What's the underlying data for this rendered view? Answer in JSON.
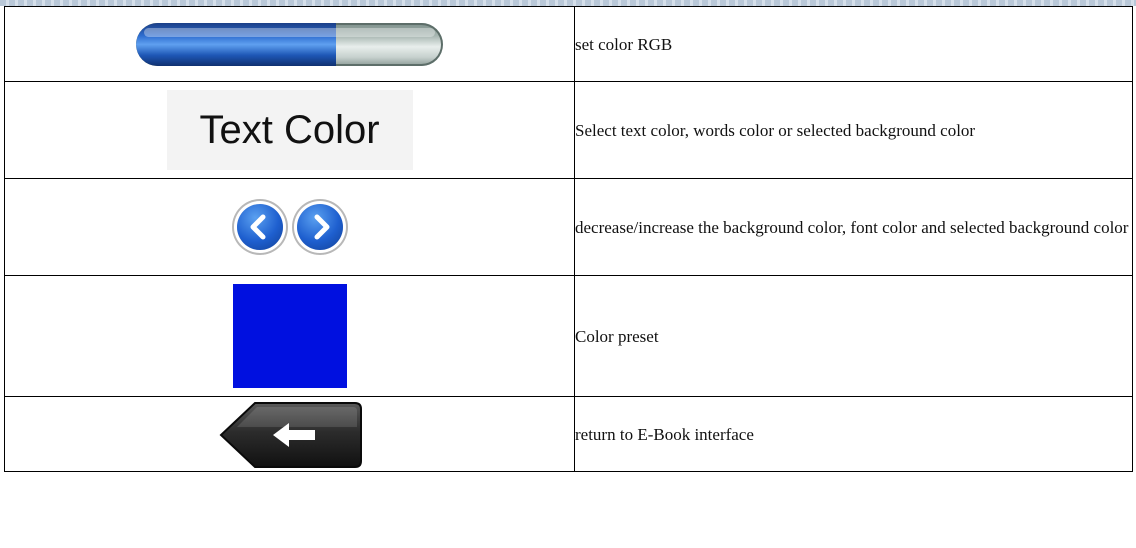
{
  "table": {
    "rows": [
      {
        "icon": "rgb-slider",
        "slider_level": 0.65,
        "description": "set color RGB"
      },
      {
        "icon": "text-color-label",
        "icon_text": "Text Color",
        "description": "Select text color, words color or selected background color"
      },
      {
        "icon": "left-right-arrows",
        "description": "decrease/increase the background color, font color and selected background color"
      },
      {
        "icon": "color-preset-swatch",
        "swatch_color": "#0010e0",
        "description": "Color preset"
      },
      {
        "icon": "back-arrow",
        "description": "return to E-Book interface"
      }
    ]
  }
}
